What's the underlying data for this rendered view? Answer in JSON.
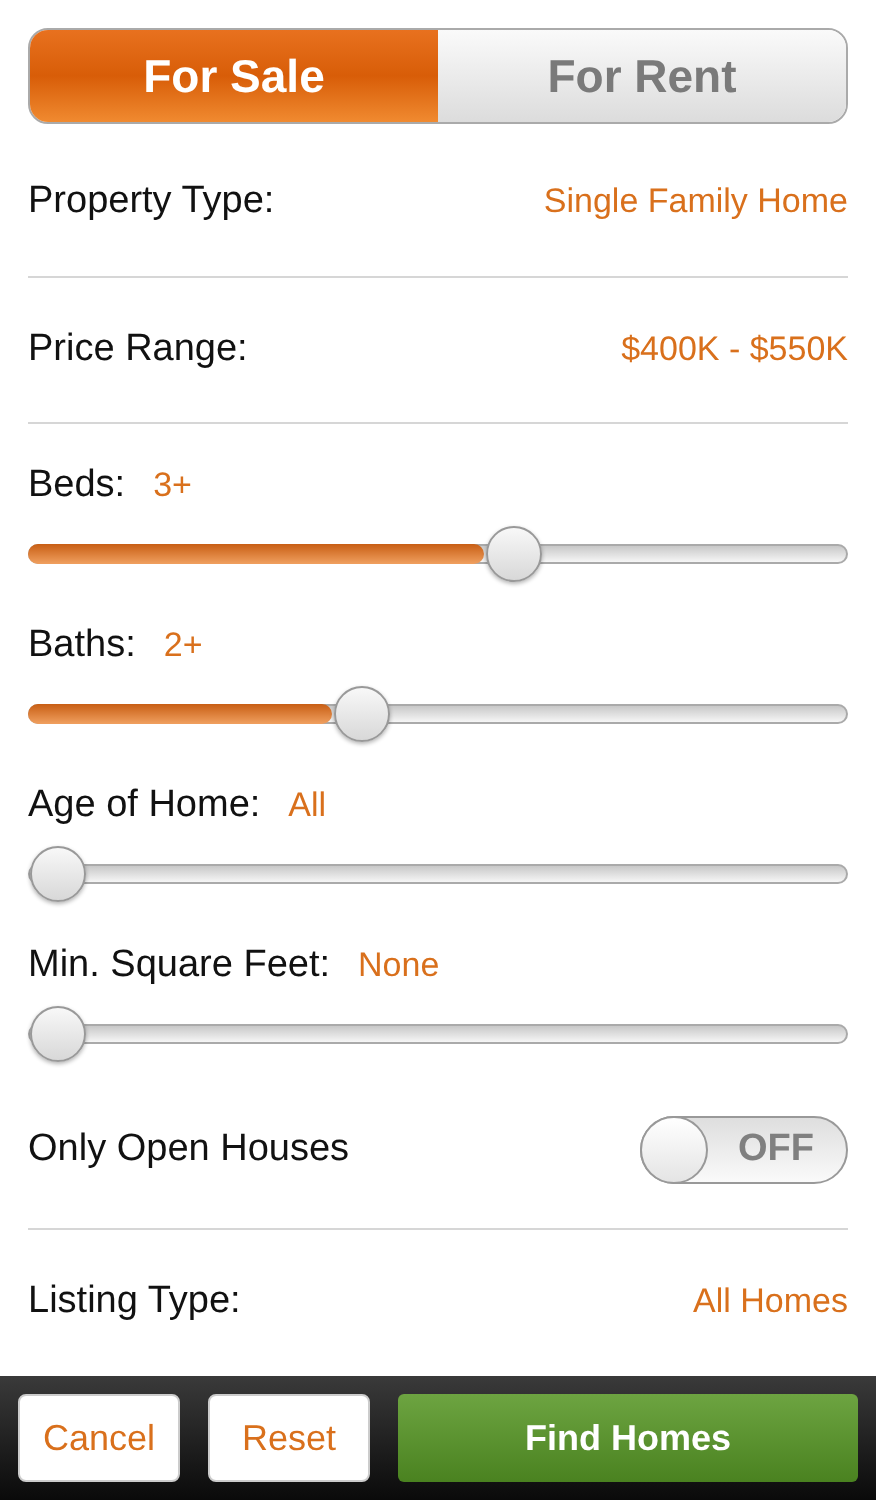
{
  "tabs": [
    {
      "label": "For Sale",
      "selected": true
    },
    {
      "label": "For Rent",
      "selected": false
    }
  ],
  "filters": [
    {
      "kind": "select",
      "label": "Property Type:",
      "value": "Single Family Home"
    },
    {
      "kind": "select",
      "label": "Price Range:",
      "value": "$400K - $550K"
    },
    {
      "kind": "slider",
      "label": "Beds:",
      "value": "3+",
      "level": 0.6
    },
    {
      "kind": "slider",
      "label": "Baths:",
      "value": "2+",
      "level": 0.4
    },
    {
      "kind": "slider",
      "label": "Age of Home:",
      "value": "All",
      "level": 0
    },
    {
      "kind": "slider",
      "label": "Min. Square Feet:",
      "value": "None",
      "level": 0
    },
    {
      "kind": "toggle",
      "label": "Only Open Houses",
      "on": false,
      "state_text": "OFF"
    },
    {
      "kind": "select",
      "label": "Listing Type:",
      "value": "All Homes"
    }
  ],
  "footer": {
    "cancel": "Cancel",
    "reset": "Reset",
    "submit": "Find Homes"
  }
}
